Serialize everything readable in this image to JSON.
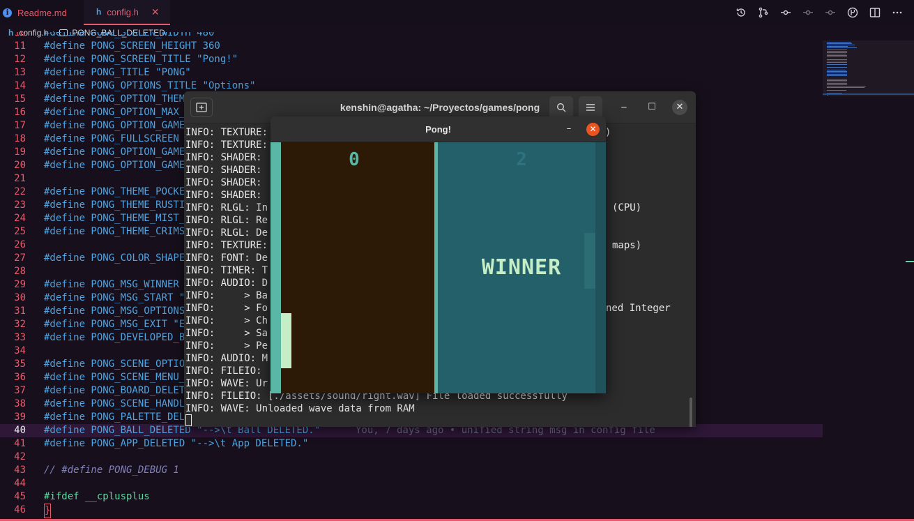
{
  "tabs": [
    {
      "icon": "i",
      "label": "Readme.md"
    },
    {
      "icon": "h",
      "label": "config.h",
      "close": "✕"
    }
  ],
  "breadcrumb": {
    "icon": "h",
    "file": "config.h",
    "symbol": "PONG_BALL_DELETED"
  },
  "editor_actions": [
    "timeline-icon",
    "source-control-icon",
    "git-compare-icon",
    "git-commit-prev-icon",
    "git-commit-next-icon",
    "git-lens-icon",
    "split-editor-icon",
    "more-icon"
  ],
  "code": {
    "active_line": 40,
    "lines": [
      {
        "n": "10",
        "t": "#define PONG_SCREEN_WIDTH 480"
      },
      {
        "n": "11",
        "t": "#define PONG_SCREEN_HEIGHT 360"
      },
      {
        "n": "12",
        "t": "#define PONG_SCREEN_TITLE \"Pong!\""
      },
      {
        "n": "13",
        "t": "#define PONG_TITLE \"PONG\""
      },
      {
        "n": "14",
        "t": "#define PONG_OPTIONS_TITLE \"Options\""
      },
      {
        "n": "15",
        "t": "#define PONG_OPTION_THEM"
      },
      {
        "n": "16",
        "t": "#define PONG_OPTION_MAX_"
      },
      {
        "n": "17",
        "t": "#define PONG_OPTION_GAME"
      },
      {
        "n": "18",
        "t": "#define PONG_FULLSCREEN"
      },
      {
        "n": "19",
        "t": "#define PONG_OPTION_GAME"
      },
      {
        "n": "20",
        "t": "#define PONG_OPTION_GAME"
      },
      {
        "n": "21",
        "t": ""
      },
      {
        "n": "22",
        "t": "#define PONG_THEME_POCKE"
      },
      {
        "n": "23",
        "t": "#define PONG_THEME_RUSTI"
      },
      {
        "n": "24",
        "t": "#define PONG_THEME_MIST_"
      },
      {
        "n": "25",
        "t": "#define PONG_THEME_CRIMS"
      },
      {
        "n": "26",
        "t": ""
      },
      {
        "n": "27",
        "t": "#define PONG_COLOR_SHAPE"
      },
      {
        "n": "28",
        "t": ""
      },
      {
        "n": "29",
        "t": "#define PONG_MSG_WINNER"
      },
      {
        "n": "30",
        "t": "#define PONG_MSG_START \""
      },
      {
        "n": "31",
        "t": "#define PONG_MSG_OPTIONS"
      },
      {
        "n": "32",
        "t": "#define PONG_MSG_EXIT \"E"
      },
      {
        "n": "33",
        "t": "#define PONG_DEVELOPED_B"
      },
      {
        "n": "34",
        "t": ""
      },
      {
        "n": "35",
        "t": "#define PONG_SCENE_OPTIO"
      },
      {
        "n": "36",
        "t": "#define PONG_SCENE_MENU_"
      },
      {
        "n": "37",
        "t": "#define PONG_BOARD_DELET"
      },
      {
        "n": "38",
        "t": "#define PONG_SCENE_HANDL"
      },
      {
        "n": "39",
        "t": "#define PONG_PALETTE_DEL"
      },
      {
        "n": "40",
        "t": "#define PONG_BALL_DELETED \"-->\\t Ball DELETED.\"",
        "blame": "You, 7 days ago • unified string msg in config file"
      },
      {
        "n": "41",
        "t": "#define PONG_APP_DELETED \"-->\\t App DELETED.\""
      },
      {
        "n": "42",
        "t": ""
      },
      {
        "n": "43",
        "t": "// #define PONG_DEBUG 1"
      },
      {
        "n": "44",
        "t": ""
      },
      {
        "n": "45",
        "t": "#ifdef __cplusplus"
      },
      {
        "n": "46",
        "t": "}"
      }
    ]
  },
  "terminal": {
    "title": "kenshin@agatha: ~/Proyectos/games/pong",
    "lines": [
      "INFO: TEXTURE:",
      "INFO: TEXTURE:",
      "INFO: SHADER:",
      "INFO: SHADER:",
      "INFO: SHADER:",
      "INFO: SHADER:",
      "INFO: RLGL: In",
      "INFO: RLGL: Re",
      "INFO: RLGL: De",
      "INFO: TEXTURE:",
      "INFO: FONT: De",
      "INFO: TIMER: T",
      "INFO: AUDIO: D",
      "INFO:     > Ba",
      "INFO:     > Fo",
      "INFO:     > Ch",
      "INFO:     > Sa",
      "INFO:     > Pe",
      "INFO: AUDIO: M",
      "INFO: FILEIO:",
      "INFO: WAVE: Ur",
      "INFO: FILEIO: [./assets/sound/right.wav] File loaded successfully",
      "INFO: WAVE: Unloaded wave data from RAM"
    ],
    "right_fragments": [
      {
        "row": 0,
        "text": ")"
      },
      {
        "row": 6,
        "text": "(CPU)"
      },
      {
        "row": 9,
        "text": "maps)"
      },
      {
        "row": 14,
        "text": "ned Integer"
      }
    ]
  },
  "pong": {
    "title": "Pong!",
    "score_left": "0",
    "score_right": "2",
    "winner_text": "WINNER",
    "colors": {
      "field_left": "#2c1a06",
      "field_right": "#23606a",
      "accent": "#5ab7a6",
      "paddle": "#c6eec6",
      "close": "#e95420"
    }
  }
}
